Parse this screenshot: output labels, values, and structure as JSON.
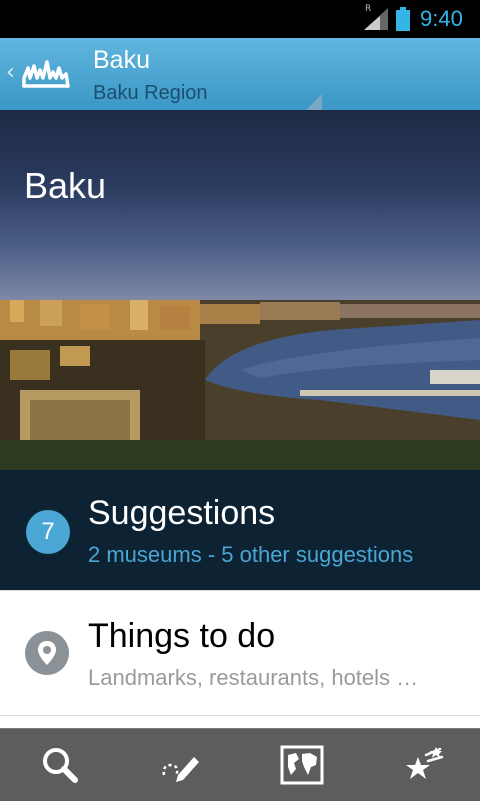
{
  "status_bar": {
    "roaming_indicator": "R",
    "time": "9:40",
    "icons": [
      "signal-icon",
      "battery-icon"
    ]
  },
  "action_bar": {
    "title": "Baku",
    "subtitle": "Baku Region",
    "icons": [
      "back-chevron-icon",
      "app-logo-icon",
      "dropdown-indicator-icon"
    ]
  },
  "hero": {
    "city_name": "Baku"
  },
  "list": {
    "suggestions": {
      "count": "7",
      "title": "Suggestions",
      "subtitle": "2 museums - 5 other suggestions"
    },
    "things_to_do": {
      "icon": "map-pin-icon",
      "title": "Things to do",
      "subtitle": "Landmarks, restaurants, hotels …"
    }
  },
  "bottom_bar": {
    "tabs": [
      {
        "icon": "search-icon"
      },
      {
        "icon": "edit-route-icon"
      },
      {
        "icon": "world-map-icon"
      },
      {
        "icon": "favorites-stars-icon"
      }
    ]
  },
  "colors": {
    "accent": "#33b5e5",
    "action_bar": "#4aa6d3",
    "suggestions_bg": "#0d2233",
    "bottom_bar": "#5d5d5d"
  }
}
